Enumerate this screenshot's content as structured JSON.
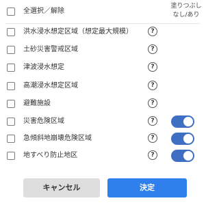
{
  "header": {
    "select_all_label": "全選択／解除",
    "fill_heading_line1": "塗りつぶし",
    "fill_heading_line2": "なし/あり"
  },
  "layers": [
    {
      "label": "洪水浸水想定区域（想定最大規模）",
      "help": "?",
      "checked": false,
      "has_toggle": false
    },
    {
      "label": "土砂災害警戒区域",
      "help": "?",
      "checked": false,
      "has_toggle": false
    },
    {
      "label": "津波浸水想定",
      "help": "?",
      "checked": false,
      "has_toggle": false
    },
    {
      "label": "高潮浸水想定区域",
      "help": "?",
      "checked": false,
      "has_toggle": false
    },
    {
      "label": "避難施設",
      "help": "?",
      "checked": false,
      "has_toggle": false
    },
    {
      "label": "災害危険区域",
      "help": "?",
      "checked": false,
      "has_toggle": true,
      "fill_on": true
    },
    {
      "label": "急傾斜地崩壊危険区域",
      "help": "?",
      "checked": false,
      "has_toggle": true,
      "fill_on": true
    },
    {
      "label": "地すべり防止地区",
      "help": "?",
      "checked": false,
      "has_toggle": true,
      "fill_on": true
    }
  ],
  "buttons": {
    "cancel_label": "キャンセル",
    "ok_label": "決定"
  },
  "colors": {
    "accent": "#2f80ed",
    "toggle_on": "#3f6fc3",
    "cancel_bg": "#dedede"
  }
}
